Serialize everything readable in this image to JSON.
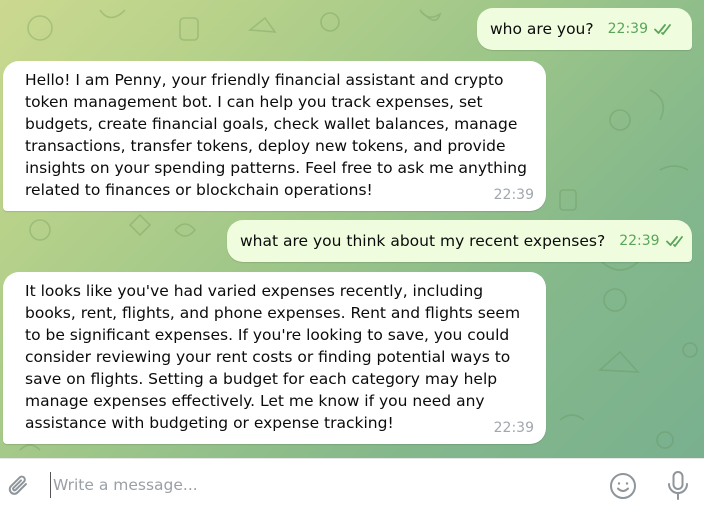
{
  "messages": [
    {
      "direction": "outgoing",
      "text": "who are you?",
      "time": "22:39",
      "status": "read"
    },
    {
      "direction": "incoming",
      "text": "Hello! I am Penny, your friendly financial assistant and crypto token management bot. I can help you track expenses, set budgets, create financial goals, check wallet balances, manage transactions, transfer tokens, deploy new tokens, and provide insights on your spending patterns. Feel free to ask me anything related to finances or blockchain operations!",
      "time": "22:39"
    },
    {
      "direction": "outgoing",
      "text": "what are you think about my recent expenses?",
      "time": "22:39",
      "status": "read"
    },
    {
      "direction": "incoming",
      "text": "It looks like you've had varied expenses recently, including books, rent, flights, and phone expenses. Rent and flights seem to be significant expenses. If you're looking to save, you could consider reviewing your rent costs or finding potential ways to save on flights. Setting a budget for each category may help manage expenses effectively. Let me know if you need any assistance with budgeting or expense tracking!",
      "time": "22:39"
    }
  ],
  "composer": {
    "placeholder": "Write a message...",
    "value": ""
  },
  "icons": {
    "attach": "paperclip-icon",
    "emoji": "smiley-icon",
    "voice": "microphone-icon",
    "read_status": "double-check-icon"
  },
  "colors": {
    "incoming_bubble": "#ffffff",
    "outgoing_bubble": "#effdde",
    "outgoing_meta": "#5aa55a",
    "incoming_meta": "#a0a7ae"
  }
}
